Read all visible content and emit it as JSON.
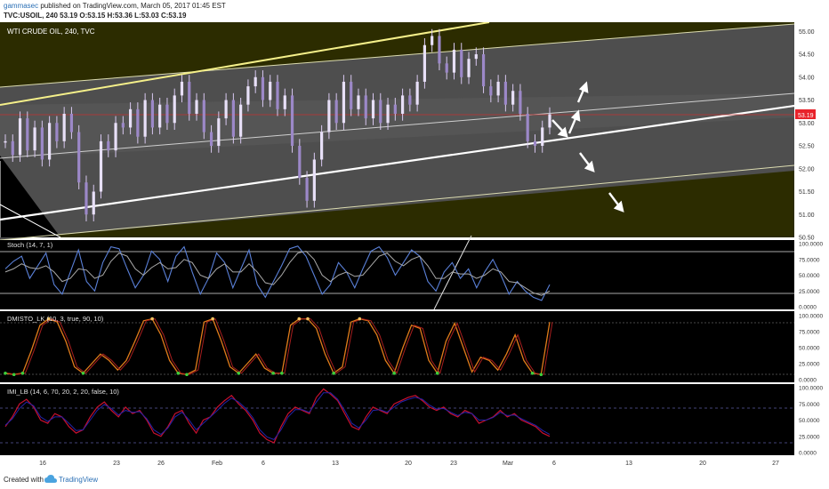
{
  "header": {
    "username": "gammasec",
    "published": "published on TradingView.com, March 05, 2017 01:45 EST",
    "ohlc": "TVC:USOIL, 240  53.19 O:53.15 H:53.36 L:53.03 C:53.19"
  },
  "footer": {
    "created_with": "Created with",
    "brand": "TradingView"
  },
  "colors": {
    "pane_bg": "#000000",
    "channel_fill": "#515151",
    "olive_fill": "#2c2c00",
    "price_tag": "#e8222a",
    "stoch_k": "#5a80d8",
    "stoch_d": "#aaaaaa",
    "dmi_line": "#e07c1a",
    "dmi_signal": "#a81e1e",
    "imi_line": "#c8102e",
    "imi_signal": "#2323a8"
  },
  "chart_data": [
    {
      "type": "line",
      "title": "WTI CRUDE OIL, 240, TVC",
      "series": [
        {
          "values": [
            52.6,
            52.3,
            53.1,
            52.4,
            52.9,
            52.2,
            53.0,
            52.6,
            53.2,
            52.8,
            51.7,
            51.0,
            51.5,
            52.6,
            52.4,
            53.0,
            52.9,
            53.3,
            52.7,
            53.5,
            52.9,
            53.4,
            53.0,
            53.6,
            53.9,
            53.2,
            53.5,
            52.8,
            52.5,
            53.1,
            53.5,
            52.7,
            53.4,
            53.8,
            54.0,
            53.5,
            53.9,
            53.3,
            53.6,
            52.5,
            51.8,
            51.3,
            52.2,
            52.8,
            53.5,
            53.0,
            53.9,
            53.3,
            53.6,
            53.1,
            53.5,
            53.0,
            53.4,
            53.2,
            53.6,
            53.4,
            53.9,
            54.7,
            54.9,
            54.3,
            54.1,
            54.6,
            54.0,
            54.4,
            54.5,
            53.8,
            53.6,
            53.9,
            53.4,
            53.7,
            53.2,
            52.6,
            52.5,
            52.9,
            53.19
          ]
        }
      ],
      "x_tick_labels": [
        "16",
        "23",
        "26",
        "Feb",
        "6",
        "13",
        "20",
        "23",
        "Mar",
        "6",
        "13",
        "20",
        "27"
      ],
      "y_tick_labels": [
        "55.00",
        "54.50",
        "54.00",
        "53.50",
        "53.00",
        "52.50",
        "52.00",
        "51.50",
        "51.00",
        "50.50"
      ],
      "ylim": [
        50.5,
        55.2
      ],
      "last_price_label": "53.19"
    },
    {
      "type": "line",
      "title": "Stoch (14, 7, 1)",
      "series": [
        {
          "values": [
            60,
            72,
            80,
            45,
            65,
            85,
            35,
            20,
            55,
            90,
            40,
            25,
            70,
            95,
            92,
            60,
            30,
            50,
            88,
            75,
            40,
            80,
            95,
            55,
            20,
            45,
            85,
            70,
            30,
            60,
            90,
            35,
            15,
            40,
            65,
            92,
            96,
            80,
            50,
            20,
            35,
            70,
            55,
            30,
            60,
            88,
            95,
            78,
            50,
            70,
            90,
            80,
            40,
            25,
            55,
            70,
            45,
            60,
            30,
            55,
            75,
            50,
            20,
            40,
            25,
            15,
            10,
            35
          ]
        },
        {
          "values": [
            55,
            60,
            68,
            62,
            60,
            65,
            55,
            40,
            45,
            60,
            58,
            45,
            50,
            72,
            85,
            80,
            60,
            50,
            62,
            70,
            60,
            62,
            75,
            70,
            50,
            45,
            60,
            68,
            55,
            55,
            68,
            55,
            38,
            35,
            50,
            70,
            85,
            88,
            75,
            50,
            40,
            50,
            55,
            48,
            50,
            65,
            80,
            85,
            72,
            65,
            75,
            80,
            65,
            45,
            45,
            55,
            52,
            52,
            45,
            50,
            60,
            55,
            40,
            38,
            30,
            22,
            18,
            25
          ]
        }
      ],
      "y_tick_labels": [
        "100.0000",
        "75.0000",
        "50.0000",
        "25.0000",
        "0.0000"
      ],
      "ylim": [
        0,
        100
      ]
    },
    {
      "type": "line",
      "title": "DMISTO_LK (10, 3, true, 90, 10)",
      "series": [
        {
          "values": [
            10,
            8,
            10,
            45,
            85,
            95,
            90,
            60,
            20,
            10,
            25,
            40,
            30,
            15,
            30,
            60,
            92,
            95,
            70,
            30,
            10,
            8,
            15,
            90,
            95,
            60,
            20,
            10,
            25,
            40,
            18,
            10,
            10,
            85,
            95,
            95,
            80,
            40,
            10,
            20,
            90,
            95,
            92,
            70,
            30,
            10,
            50,
            85,
            80,
            30,
            10,
            60,
            88,
            50,
            12,
            35,
            30,
            15,
            40,
            70,
            30,
            10,
            8,
            90
          ]
        }
      ],
      "y_tick_labels": [
        "100.0000",
        "75.0000",
        "50.0000",
        "25.0000",
        "0.0000"
      ],
      "ylim": [
        0,
        100
      ]
    },
    {
      "type": "line",
      "title": "IMI_LB (14, 6, 70, 20, 2, 20, false, 10)",
      "series": [
        {
          "values": [
            40,
            55,
            75,
            82,
            70,
            50,
            45,
            60,
            55,
            40,
            30,
            35,
            55,
            70,
            78,
            65,
            55,
            70,
            60,
            65,
            50,
            30,
            25,
            40,
            60,
            65,
            45,
            30,
            50,
            55,
            70,
            80,
            88,
            75,
            65,
            50,
            30,
            20,
            15,
            40,
            60,
            70,
            65,
            60,
            85,
            98,
            90,
            80,
            60,
            40,
            35,
            55,
            70,
            65,
            60,
            75,
            80,
            85,
            88,
            80,
            70,
            65,
            70,
            60,
            55,
            65,
            60,
            45,
            50,
            55,
            65,
            55,
            60,
            50,
            45,
            40,
            30,
            25
          ]
        },
        {
          "values": [
            42,
            52,
            68,
            78,
            72,
            55,
            48,
            55,
            55,
            45,
            34,
            35,
            50,
            65,
            74,
            68,
            58,
            65,
            62,
            63,
            52,
            35,
            28,
            38,
            55,
            62,
            50,
            35,
            45,
            55,
            65,
            76,
            84,
            78,
            68,
            54,
            35,
            24,
            20,
            35,
            55,
            66,
            66,
            62,
            78,
            92,
            92,
            82,
            65,
            45,
            38,
            50,
            65,
            66,
            62,
            70,
            78,
            82,
            85,
            82,
            73,
            67,
            68,
            62,
            57,
            62,
            60,
            50,
            50,
            54,
            62,
            57,
            58,
            52,
            47,
            42,
            34,
            28
          ]
        }
      ],
      "y_tick_labels": [
        "100.0000",
        "75.0000",
        "50.0000",
        "25.0000",
        "0.0000"
      ],
      "ylim": [
        0,
        100
      ]
    }
  ]
}
